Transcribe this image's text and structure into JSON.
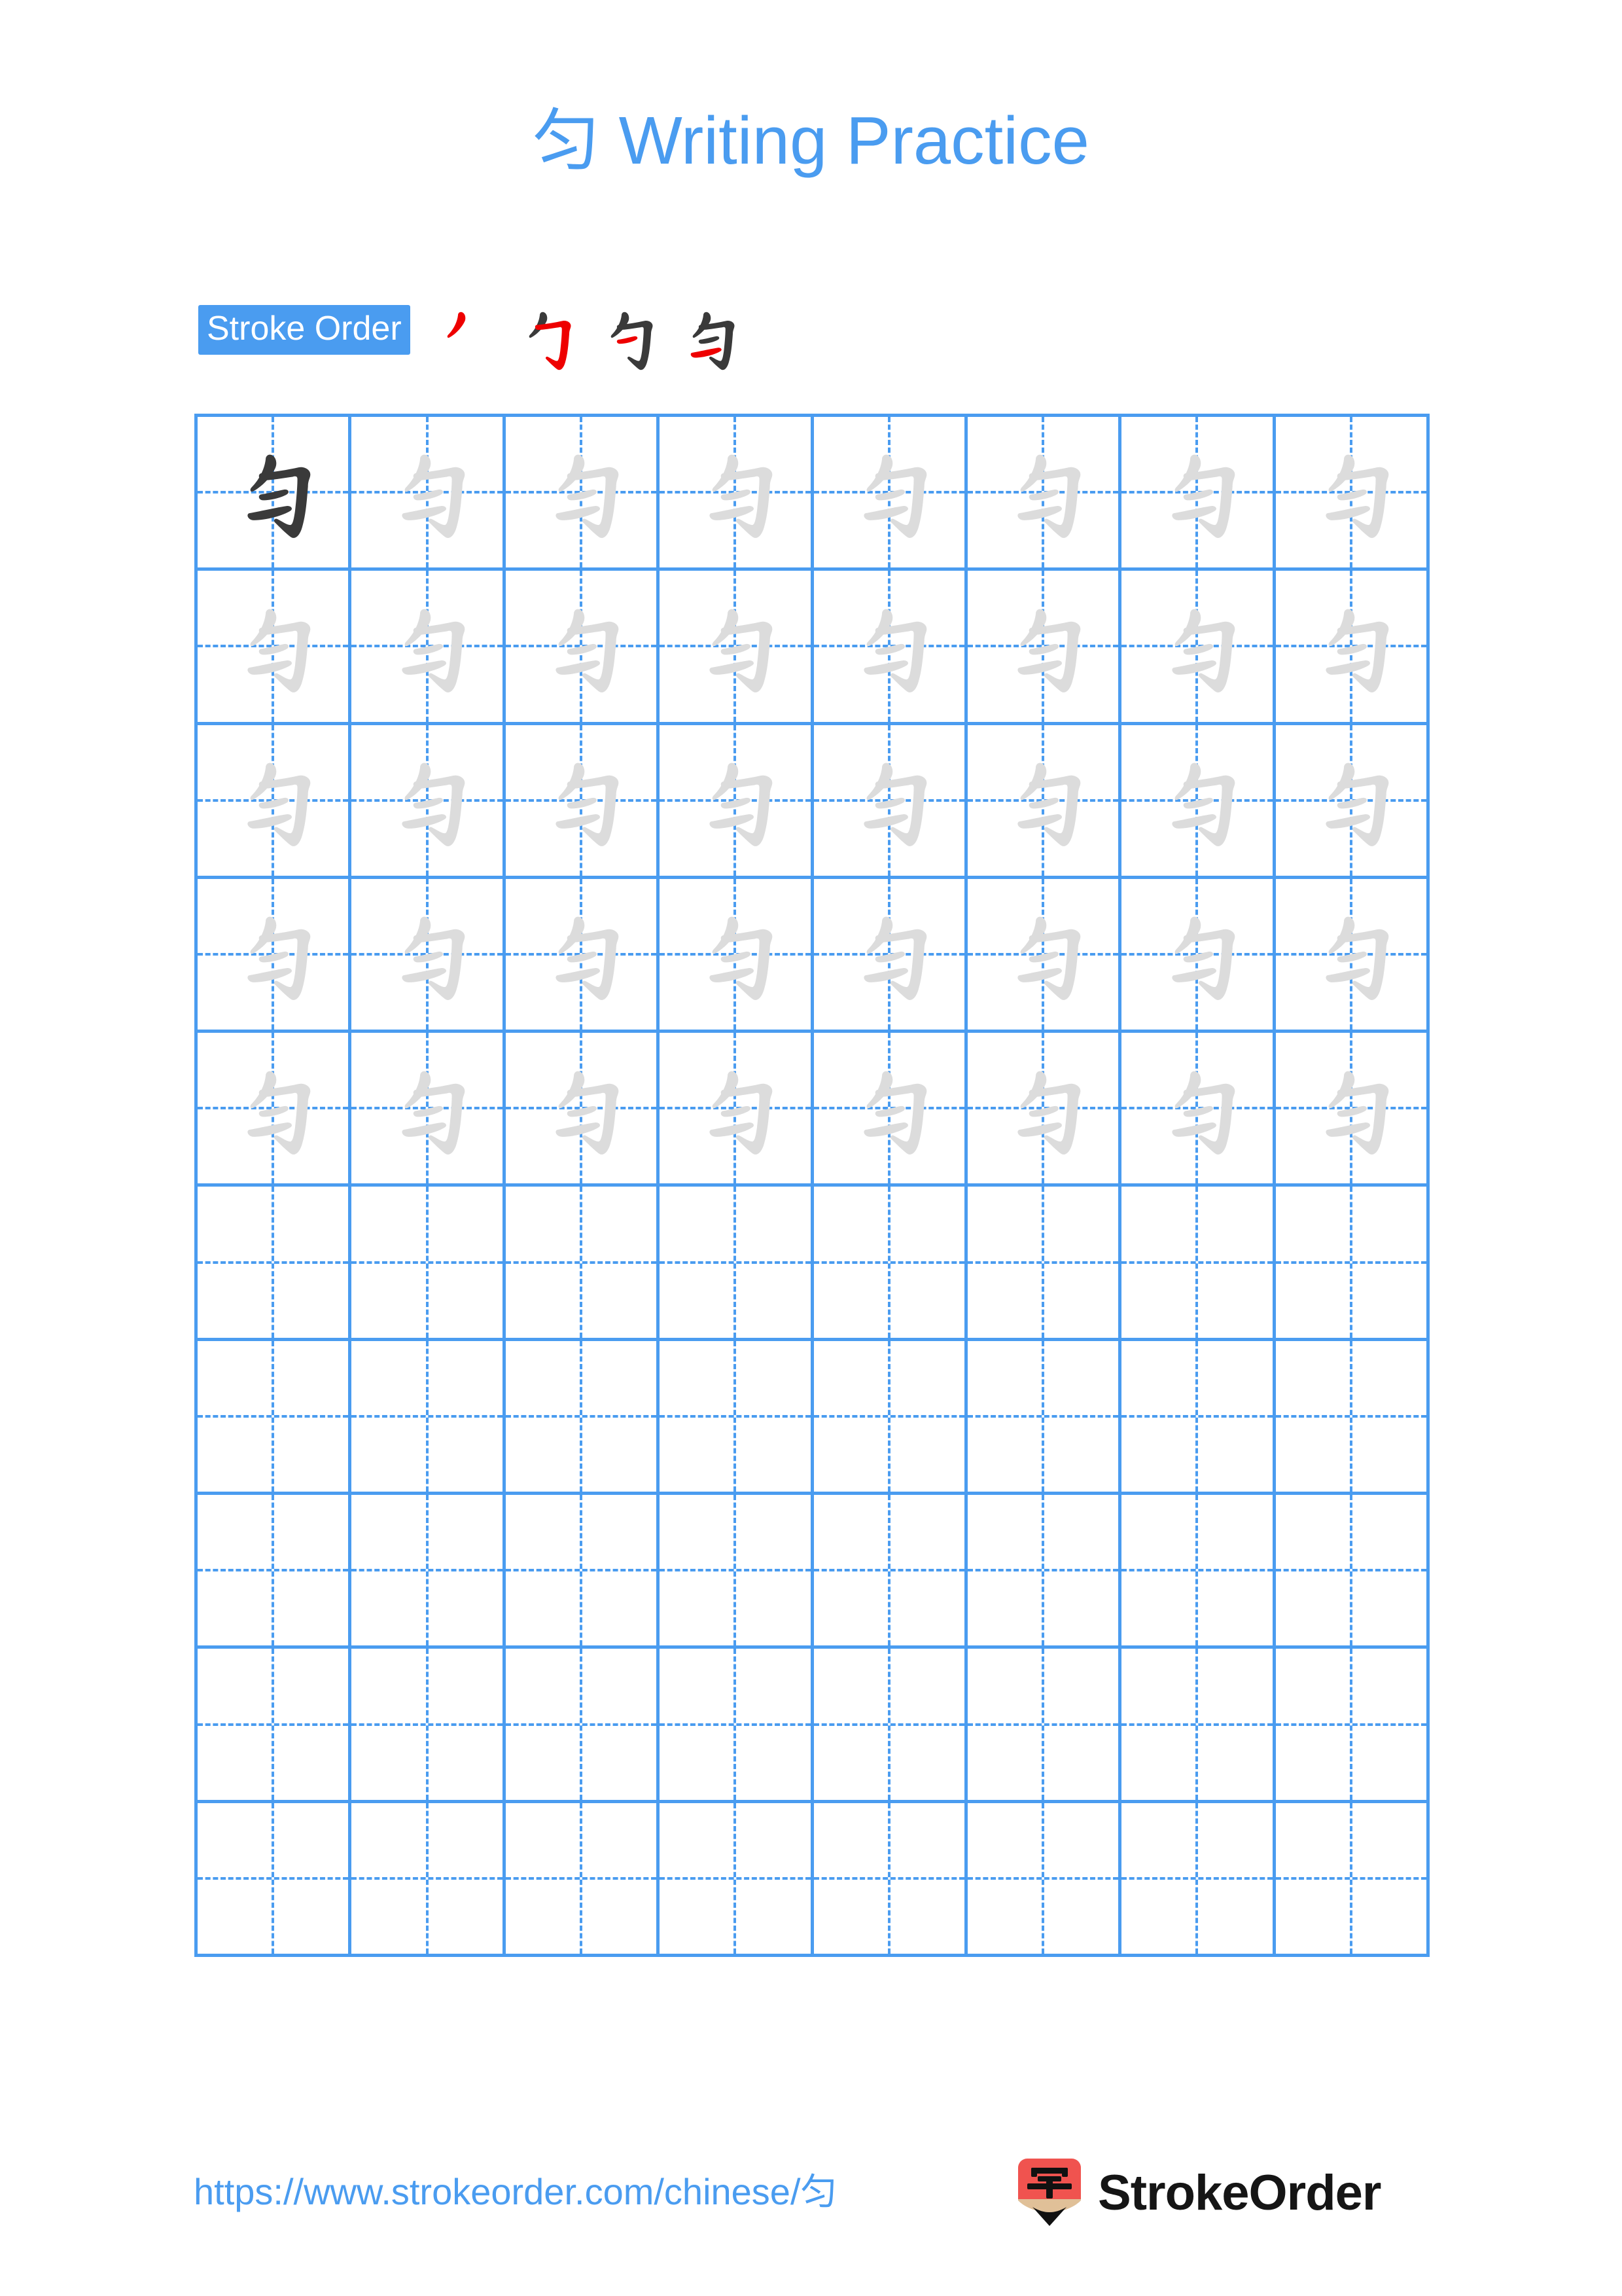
{
  "page": {
    "character": "匀",
    "title": "匀 Writing Practice",
    "background_color": "#ffffff",
    "accent_color": "#4a9cf0"
  },
  "stroke_order": {
    "badge_label": "Stroke Order",
    "badge_bg_color": "#4a9cf0",
    "badge_text_color": "#ffffff",
    "highlight_color": "#ee0000",
    "ink_color": "#3a3a3a",
    "total_strokes": 4,
    "steps": [
      {
        "index": 1,
        "name": "stroke-step-1",
        "stroke_name": "pie",
        "new_stroke_color": "#ee0000"
      },
      {
        "index": 2,
        "name": "stroke-step-2",
        "stroke_name": "heng-zhe-gou",
        "new_stroke_color": "#ee0000"
      },
      {
        "index": 3,
        "name": "stroke-step-3",
        "stroke_name": "heng-upper",
        "new_stroke_color": "#ee0000"
      },
      {
        "index": 4,
        "name": "stroke-step-4",
        "stroke_name": "heng-lower",
        "new_stroke_color": "#ee0000"
      }
    ]
  },
  "practice_grid": {
    "columns": 8,
    "rows": 10,
    "grid_line_color": "#4a9cf0",
    "guide_line_style": "dashed",
    "model_char_color": "#3a3a3a",
    "trace_char_color": "#dcdcdc",
    "cells": [
      [
        "model",
        "trace",
        "trace",
        "trace",
        "trace",
        "trace",
        "trace",
        "trace"
      ],
      [
        "trace",
        "trace",
        "trace",
        "trace",
        "trace",
        "trace",
        "trace",
        "trace"
      ],
      [
        "trace",
        "trace",
        "trace",
        "trace",
        "trace",
        "trace",
        "trace",
        "trace"
      ],
      [
        "trace",
        "trace",
        "trace",
        "trace",
        "trace",
        "trace",
        "trace",
        "trace"
      ],
      [
        "trace",
        "trace",
        "trace",
        "trace",
        "trace",
        "trace",
        "trace",
        "trace"
      ],
      [
        "empty",
        "empty",
        "empty",
        "empty",
        "empty",
        "empty",
        "empty",
        "empty"
      ],
      [
        "empty",
        "empty",
        "empty",
        "empty",
        "empty",
        "empty",
        "empty",
        "empty"
      ],
      [
        "empty",
        "empty",
        "empty",
        "empty",
        "empty",
        "empty",
        "empty",
        "empty"
      ],
      [
        "empty",
        "empty",
        "empty",
        "empty",
        "empty",
        "empty",
        "empty",
        "empty"
      ],
      [
        "empty",
        "empty",
        "empty",
        "empty",
        "empty",
        "empty",
        "empty",
        "empty"
      ]
    ]
  },
  "footer": {
    "url": "https://www.strokeorder.com/chinese/匀",
    "url_color": "#4a9cf0",
    "brand_name": "StrokeOrder",
    "logo_character": "字",
    "logo_bg_color": "#f0534f",
    "logo_pencil_color": "#e0c098",
    "logo_tip_color": "#111111"
  }
}
